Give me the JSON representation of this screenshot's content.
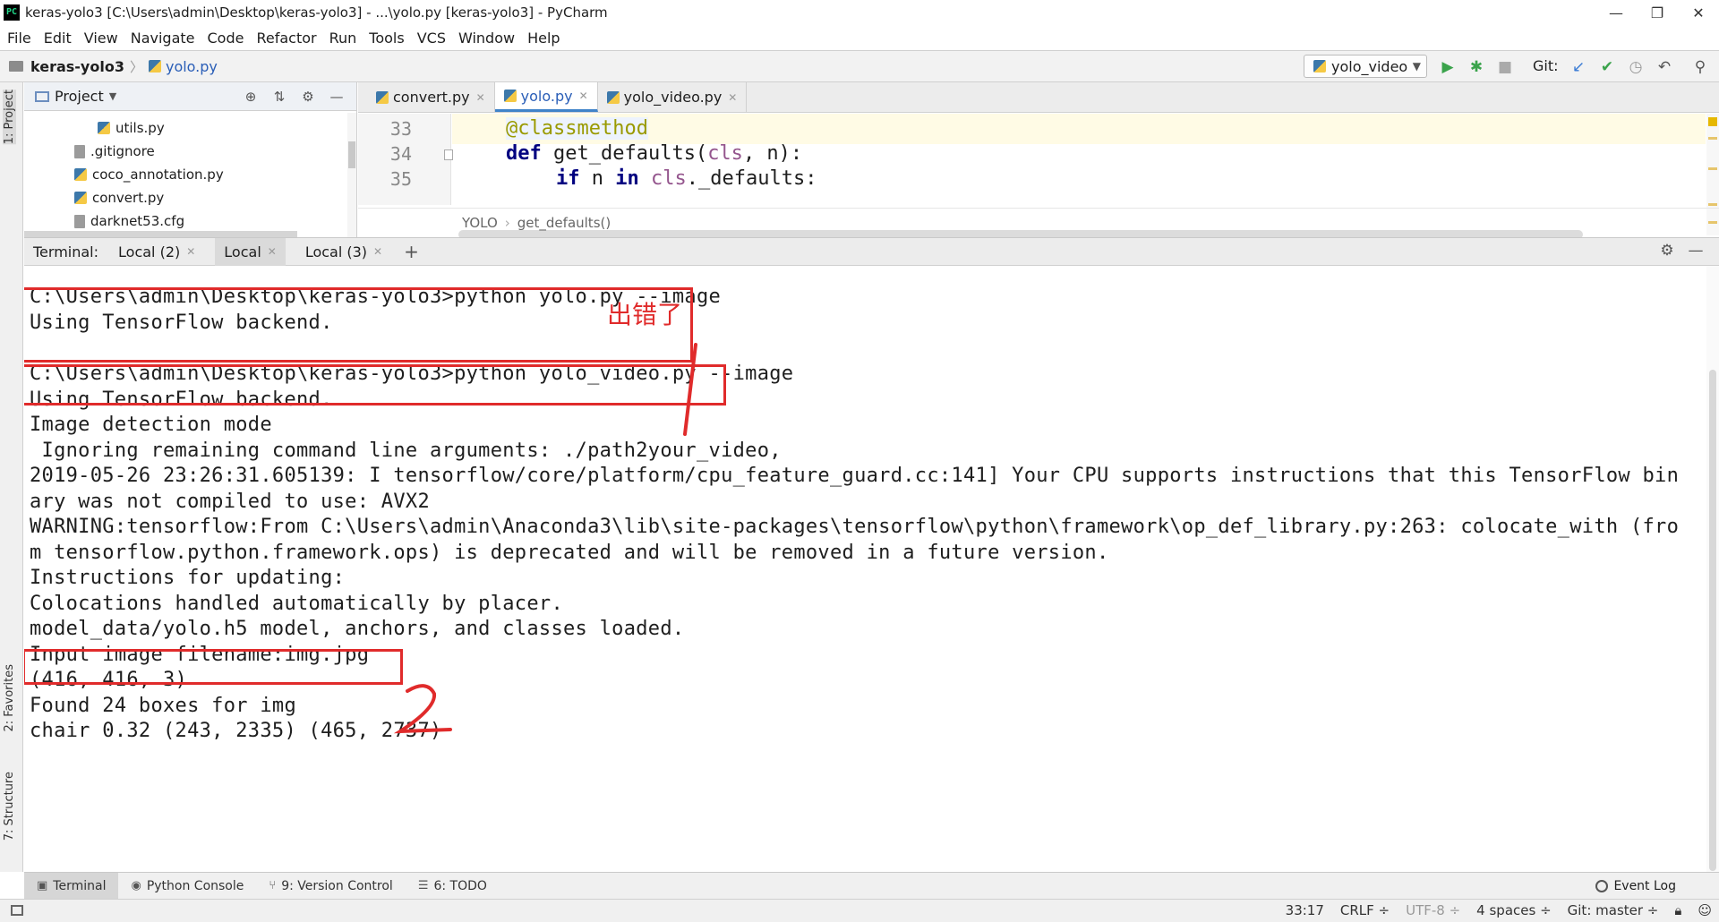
{
  "window": {
    "title": "keras-yolo3 [C:\\Users\\admin\\Desktop\\keras-yolo3] - ...\\yolo.py [keras-yolo3] - PyCharm",
    "app_logo": "PC",
    "controls": [
      "—",
      "❐",
      "✕"
    ]
  },
  "menu": [
    "File",
    "Edit",
    "View",
    "Navigate",
    "Code",
    "Refactor",
    "Run",
    "Tools",
    "VCS",
    "Window",
    "Help"
  ],
  "navbar": {
    "project": "keras-yolo3",
    "file": "yolo.py",
    "run_config": "yolo_video",
    "git_label": "Git:"
  },
  "left_strip": {
    "project_tab": "1: Project",
    "favorites_tab": "2: Favorites",
    "structure_tab": "7: Structure"
  },
  "project_panel": {
    "title": "Project",
    "items": [
      {
        "name": "utils.py",
        "type": "py"
      },
      {
        "name": ".gitignore",
        "type": "file"
      },
      {
        "name": "coco_annotation.py",
        "type": "py"
      },
      {
        "name": "convert.py",
        "type": "py"
      },
      {
        "name": "darknet53.cfg",
        "type": "file"
      }
    ]
  },
  "editor": {
    "tabs": [
      {
        "label": "convert.py",
        "active": false
      },
      {
        "label": "yolo.py",
        "active": true
      },
      {
        "label": "yolo_video.py",
        "active": false
      }
    ],
    "line_numbers": [
      "33",
      "34",
      "35"
    ],
    "code": {
      "line1_decorator": "@classmethod",
      "line2_kw": "def",
      "line2_name": " get_defaults(",
      "line2_cls": "cls",
      "line2_rest": ", n):",
      "line3_if": "if",
      "line3_n": " n ",
      "line3_in": "in",
      "line3_cls": "cls",
      "line3_rest": "._defaults:"
    },
    "breadcrumb_class": "YOLO",
    "breadcrumb_method": "get_defaults()"
  },
  "terminal": {
    "label": "Terminal:",
    "tabs": [
      {
        "label": "Local (2)",
        "active": false
      },
      {
        "label": "Local",
        "active": true
      },
      {
        "label": "Local (3)",
        "active": false
      }
    ],
    "lines": [
      "C:\\Users\\admin\\Desktop\\keras-yolo3>python yolo.py --image",
      "Using TensorFlow backend.",
      "",
      "C:\\Users\\admin\\Desktop\\keras-yolo3>python yolo_video.py --image",
      "Using TensorFlow backend.",
      "Image detection mode",
      " Ignoring remaining command line arguments: ./path2your_video,",
      "2019-05-26 23:26:31.605139: I tensorflow/core/platform/cpu_feature_guard.cc:141] Your CPU supports instructions that this TensorFlow bin",
      "ary was not compiled to use: AVX2",
      "WARNING:tensorflow:From C:\\Users\\admin\\Anaconda3\\lib\\site-packages\\tensorflow\\python\\framework\\op_def_library.py:263: colocate_with (fro",
      "m tensorflow.python.framework.ops) is deprecated and will be removed in a future version.",
      "Instructions for updating:",
      "Colocations handled automatically by placer.",
      "model_data/yolo.h5 model, anchors, and classes loaded.",
      "Input image filename:img.jpg",
      "(416, 416, 3)",
      "Found 24 boxes for img",
      "chair 0.32 (243, 2335) (465, 2737)"
    ],
    "annotation_text": "出错了"
  },
  "bottom_tools": [
    {
      "label": "Terminal",
      "active": true
    },
    {
      "label": "Python Console",
      "active": false
    },
    {
      "label": "9: Version Control",
      "active": false
    },
    {
      "label": "6: TODO",
      "active": false
    }
  ],
  "event_log": "Event Log",
  "status": {
    "position": "33:17",
    "line_sep": "CRLF ÷",
    "encoding": "UTF-8 ÷",
    "indent": "4 spaces ÷",
    "git": "Git: master ÷"
  },
  "colors": {
    "annotation_red": "#e02b2b",
    "keyword": "#000080",
    "self_param": "#94558d",
    "decorator": "#9a9a00",
    "active_tab_accent": "#4083c9"
  }
}
